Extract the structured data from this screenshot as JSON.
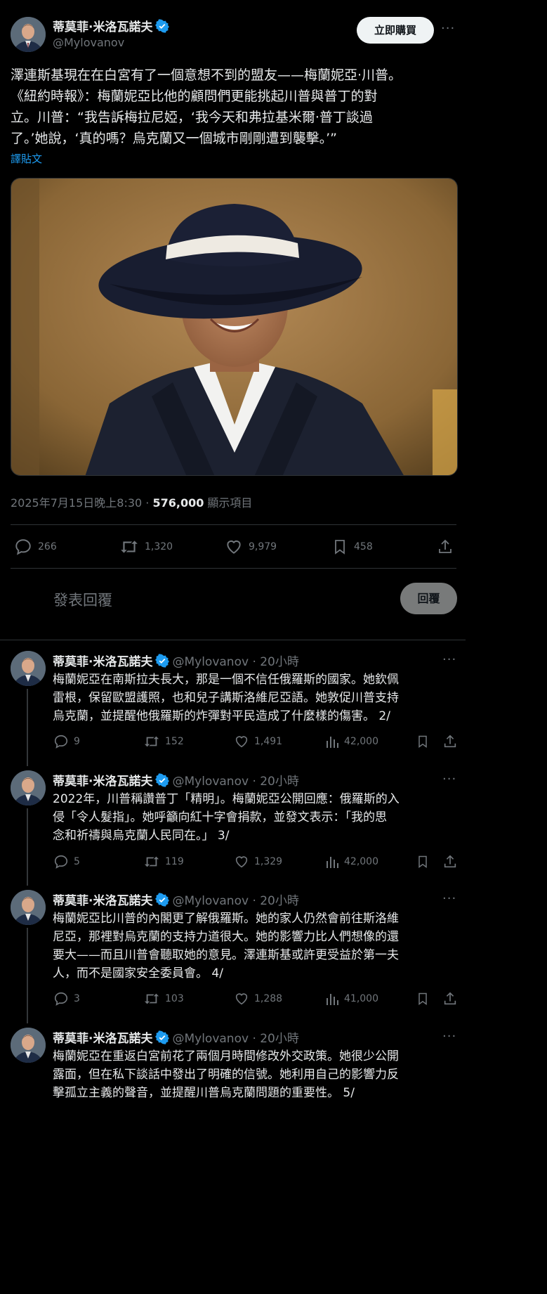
{
  "main": {
    "author_name": "蒂莫菲·米洛瓦諾夫",
    "handle": "@Mylovanov",
    "buy_button": "立即購買",
    "more": "···",
    "text_lines": [
      "澤連斯基現在在白宮有了一個意想不到的盟友——梅蘭妮亞·川普。",
      "《紐約時報》：梅蘭妮亞比他的顧問們更能挑起川普與普丁的對",
      "立。川普：“我告訴梅拉尼婭，‘我今天和弗拉基米爾·普丁談過",
      "了。’她說，‘真的嗎？烏克蘭又一個城市剛剛遭到襲擊。’”"
    ],
    "translate_link": "譯貼文",
    "timestamp": "2025年7月15日晚上8:30",
    "separator": " · ",
    "views_count": "576,000",
    "views_label": " 顯示項目",
    "actions": {
      "replies": "266",
      "reposts": "1,320",
      "likes": "9,979",
      "bookmarks": "458"
    },
    "reply_placeholder": "發表回覆",
    "reply_button": "回覆"
  },
  "thread": [
    {
      "name": "蒂莫菲·米洛瓦諾夫",
      "handle": "@Mylovanov · 20小時",
      "lines": [
        "梅蘭妮亞在南斯拉夫長大，那是一個不信任俄羅斯的國家。她欽佩",
        "雷根，保留歐盟護照，也和兒子講斯洛維尼亞語。她敦促川普支持",
        "烏克蘭，並提醒他俄羅斯的炸彈對平民造成了什麼樣的傷害。 2/"
      ],
      "replies": "9",
      "reposts": "152",
      "likes": "1,491",
      "views": "42,000"
    },
    {
      "name": "蒂莫菲·米洛瓦諾夫",
      "handle": "@Mylovanov · 20小時",
      "lines": [
        "2022年，川普稱讚普丁「精明」。梅蘭妮亞公開回應：俄羅斯的入",
        "侵「令人髮指」。她呼籲向紅十字會捐款，並發文表示：「我的思",
        "念和祈禱與烏克蘭人民同在。」 3/"
      ],
      "replies": "5",
      "reposts": "119",
      "likes": "1,329",
      "views": "42,000"
    },
    {
      "name": "蒂莫菲·米洛瓦諾夫",
      "handle": "@Mylovanov · 20小時",
      "lines": [
        "梅蘭妮亞比川普的內閣更了解俄羅斯。她的家人仍然會前往斯洛維",
        "尼亞，那裡對烏克蘭的支持力道很大。她的影響力比人們想像的還",
        "要大——而且川普會聽取她的意見。澤連斯基或許更受益於第一夫",
        "人，而不是國家安全委員會。 4/"
      ],
      "replies": "3",
      "reposts": "103",
      "likes": "1,288",
      "views": "41,000"
    },
    {
      "name": "蒂莫菲·米洛瓦諾夫",
      "handle": "@Mylovanov · 20小時",
      "lines": [
        "梅蘭妮亞在重返白宮前花了兩個月時間修改外交政策。她很少公開",
        "露面，但在私下談話中發出了明確的信號。她利用自己的影響力反",
        "擊孤立主義的聲音，並提醒川普烏克蘭問題的重要性。 5/"
      ]
    }
  ],
  "colors": {
    "background": "#000000",
    "text": "#e7e9ea",
    "muted": "#71767b",
    "link": "#1d9bf0",
    "verified": "#1d9bf0",
    "divider": "#2f3336"
  }
}
